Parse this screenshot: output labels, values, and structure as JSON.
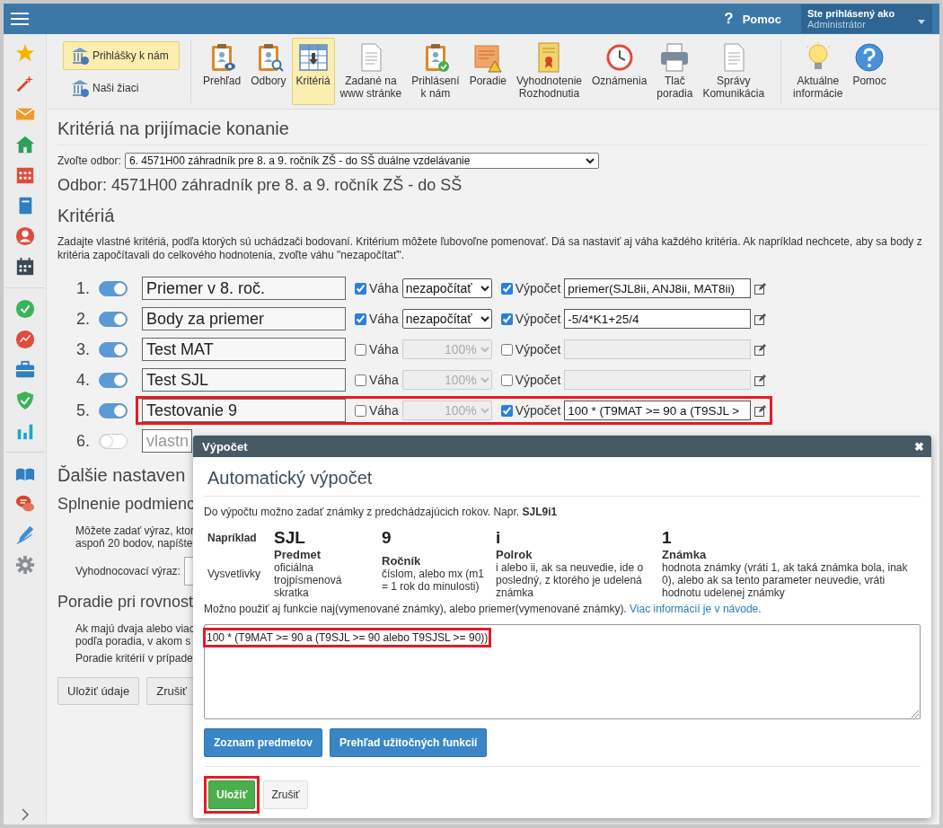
{
  "top_bar": {
    "help_mark": "?",
    "help": "Pomoc",
    "user_label": "Ste prihlásený ako",
    "user_name": "Administrátor"
  },
  "toolbar": {
    "side_buttons": [
      {
        "label": "Prihlášky k nám",
        "selected": true
      },
      {
        "label": "Naši žiaci",
        "selected": false
      }
    ],
    "buttons": [
      {
        "label": "Prehľad",
        "kind": "clipboard-eye",
        "selected": false
      },
      {
        "label": "Odbory",
        "kind": "clipboard-search",
        "selected": false
      },
      {
        "label": "Kritériá",
        "kind": "table",
        "selected": true
      },
      {
        "label": "Zadané na\nwww stránke",
        "kind": "document",
        "selected": false
      },
      {
        "label": "Prihlásení\nk nám",
        "kind": "clipboard-check",
        "selected": false
      },
      {
        "label": "Poradie",
        "kind": "warning-page",
        "selected": false
      },
      {
        "label": "Vyhodnotenie\nRozhodnutia",
        "kind": "certificate",
        "selected": false
      },
      {
        "label": "Oznámenia",
        "kind": "clock",
        "selected": false
      },
      {
        "label": "Tlač\nporadia",
        "kind": "printer",
        "selected": false
      },
      {
        "label": "Správy\nKomunikácia",
        "kind": "document",
        "selected": false
      },
      {
        "label": "Aktuálne\ninformácie",
        "kind": "bulb",
        "selected": false
      },
      {
        "label": "Pomoc",
        "kind": "help",
        "selected": false
      }
    ]
  },
  "page": {
    "title": "Kritériá na prijímacie konanie",
    "branch_label": "Zvoľte odbor:",
    "branch_value": "6. 4571H00 záhradník pre 8. a 9. ročník ZŠ - do SŠ duálne vzdelávanie",
    "branch_heading": "Odbor: 4571H00 záhradník pre 8. a 9. ročník ZŠ - do SŠ",
    "criteria_heading": "Kritériá",
    "criteria_intro": "Zadajte vlastné kritériá, podľa ktorých sú uchádzači bodovaní. Kritérium môžete ľubovoľne pomenovať. Dá sa nastaviť aj váha každého kritéria. Ak napríklad nechcete, aby sa body z kritéria započítavali do celkového hodnotenia, zvoľte váhu \"nezapočítať\"."
  },
  "criteria": [
    {
      "number": "1.",
      "on": true,
      "name": "Priemer v 8. roč.",
      "weight_checked": true,
      "weight_label": "Váha",
      "weight": "nezapočítať",
      "calc_checked": true,
      "calc_label": "Výpočet",
      "calc": "priemer(SJL8ii, ANJ8ii, MAT8ii)",
      "highlighted": false
    },
    {
      "number": "2.",
      "on": true,
      "name": "Body za priemer",
      "weight_checked": true,
      "weight_label": "Váha",
      "weight": "nezapočítať",
      "calc_checked": true,
      "calc_label": "Výpočet",
      "calc": "-5/4*K1+25/4",
      "highlighted": false
    },
    {
      "number": "3.",
      "on": true,
      "name": "Test MAT",
      "weight_checked": false,
      "weight_label": "Váha",
      "weight": "100%",
      "calc_checked": false,
      "calc_label": "Výpočet",
      "highlighted": false
    },
    {
      "number": "4.",
      "on": true,
      "name": "Test SJL",
      "weight_checked": false,
      "weight_label": "Váha",
      "weight": "100%",
      "calc_checked": false,
      "calc_label": "Výpočet",
      "highlighted": false
    },
    {
      "number": "5.",
      "on": true,
      "name": "Testovanie 9",
      "weight_checked": false,
      "weight_label": "Váha",
      "weight": "100%",
      "calc_checked": true,
      "calc_label": "Výpočet",
      "calc": "100 * (T9MAT >= 90 a (T9SJL >",
      "highlighted": true
    },
    {
      "number": "6.",
      "on": false,
      "placeholder": "vlastn"
    }
  ],
  "more_settings": {
    "heading": "Ďalšie nastaven",
    "condition_heading": "Splnenie podmienc",
    "condition_text": [
      "Môžete zadať výraz, ktor",
      "aspoň 20 bodov, napíšte"
    ],
    "expression_label": "Vyhodnocovací výraz:",
    "ties_heading": "Poradie pri rovnost",
    "ties_text": [
      "Ak majú dvaja alebo viac",
      "podľa poradia, v akom s",
      "Poradie kritérií v prípade"
    ]
  },
  "buttons": [
    "Uložiť údaje",
    "Zrušiť"
  ],
  "modal": {
    "title": "Výpočet",
    "close": "✖",
    "heading": "Automatický výpočet",
    "intro": "Do výpočtu možno zadať známky z predchádzajúcich rokov. Napr. **SJL9i1**",
    "example_label": "Napríklad",
    "explain_label": "Vysvetlivky",
    "example": [
      {
        "value": "SJL",
        "title": "Predmet",
        "description": "oficiálna trojpísmenová skratka"
      },
      {
        "value": "9",
        "title": "Ročník",
        "description": "číslom, alebo mx (m1 = 1 rok do minulosti)"
      },
      {
        "value": "i",
        "title": "Polrok",
        "description": "i alebo ii, ak sa neuvedie, ide o posledný, z ktorého je udelená známka"
      },
      {
        "value": "1",
        "title": "Známka",
        "description": "hodnota známky (vráti 1, ak taká známka bola, inak 0), alebo ak sa tento parameter neuvedie, vráti hodnotu udelenej známky"
      }
    ],
    "note": "Možno použiť aj funkcie naj(vymenované známky), alebo priemer(vymenované známky).",
    "link": "Viac informácií je v návode.",
    "expression": "100 * (T9MAT >= 90 a (T9SJL >= 90 alebo T9SJSL >= 90))",
    "expression_highlighted": true,
    "tool_buttons": [
      "Zoznam predmetov",
      "Prehľad užitočných funkcií"
    ],
    "save": {
      "label": "Uložiť",
      "highlighted": true
    },
    "cancel": "Zrušiť"
  }
}
